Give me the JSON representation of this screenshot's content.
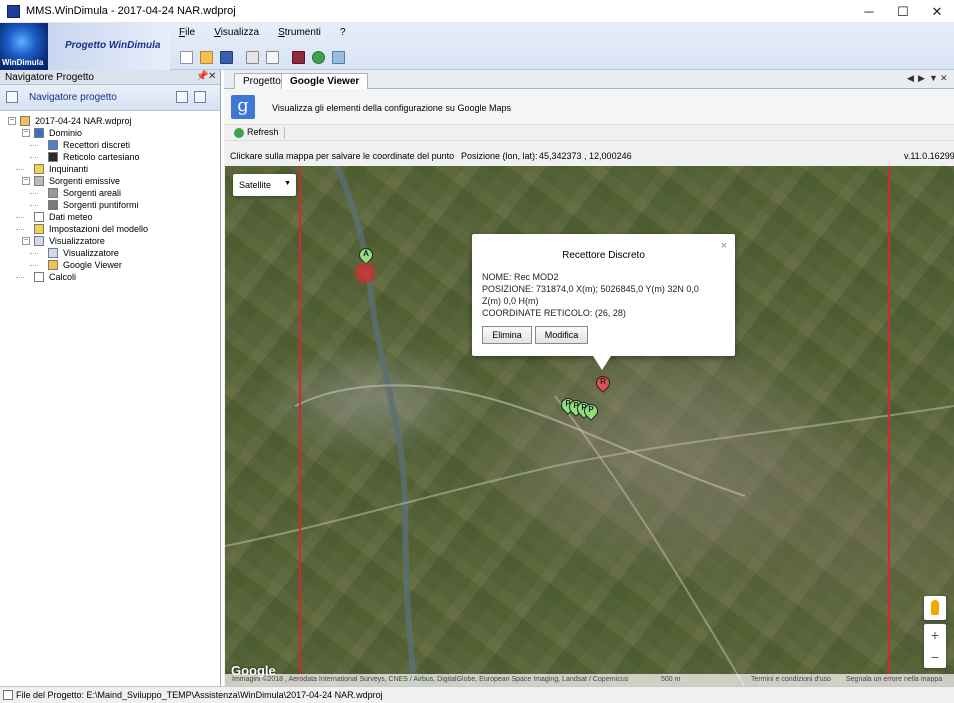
{
  "window": {
    "title": "MMS.WinDimula - 2017-04-24 NAR.wdproj",
    "minimize": "─",
    "maximize": "☐",
    "close": "✕"
  },
  "logo": {
    "text": "WinDimula",
    "project_label": "Progetto WinDimula"
  },
  "menu": [
    "File",
    "Visualizza",
    "Strumenti",
    "?"
  ],
  "toolbar_icons": [
    "new-file-icon",
    "open-folder-icon",
    "save-icon",
    "table-icon",
    "report-icon",
    "book-icon",
    "globe-icon",
    "export-icon"
  ],
  "navigator": {
    "title": "Navigatore Progetto",
    "pin": "📌",
    "close": "✕",
    "bar_label": "Navigatore progetto",
    "tree": [
      {
        "label": "2017-04-24 NAR.wdproj",
        "level": 0,
        "icon": "project-icon",
        "expand": "−"
      },
      {
        "label": "Dominio",
        "level": 1,
        "icon": "domain-icon",
        "expand": "−"
      },
      {
        "label": "Recettori discreti",
        "level": 2,
        "icon": "receptors-icon"
      },
      {
        "label": "Reticolo cartesiano",
        "level": 2,
        "icon": "grid-icon"
      },
      {
        "label": "Inquinanti",
        "level": 1,
        "icon": "pollutants-icon"
      },
      {
        "label": "Sorgenti emissive",
        "level": 1,
        "icon": "sources-icon",
        "expand": "−"
      },
      {
        "label": "Sorgenti areali",
        "level": 2,
        "icon": "area-sources-icon"
      },
      {
        "label": "Sorgenti puntiformi",
        "level": 2,
        "icon": "point-sources-icon"
      },
      {
        "label": "Dati meteo",
        "level": 1,
        "icon": "meteo-icon"
      },
      {
        "label": "Impostazioni del modello",
        "level": 1,
        "icon": "settings-icon"
      },
      {
        "label": "Visualizzatore",
        "level": 1,
        "icon": "viewer-icon",
        "expand": "−"
      },
      {
        "label": "Visualizzatore",
        "level": 2,
        "icon": "viewer-icon"
      },
      {
        "label": "Google Viewer",
        "level": 2,
        "icon": "google-viewer-icon"
      },
      {
        "label": "Calcoli",
        "level": 1,
        "icon": "calc-icon"
      }
    ]
  },
  "tabs": [
    {
      "label": "Progetto",
      "active": false
    },
    {
      "label": "Google Viewer",
      "active": true
    }
  ],
  "tab_controls": {
    "prev": "◀",
    "next": "▶",
    "menu": "▼",
    "close": "✕"
  },
  "google_viewer": {
    "logo": "g",
    "description": "Visualizza gli elementi della configurazione su Google Maps",
    "refresh_label": "Refresh",
    "hint": "Clickare sulla mappa per salvare le coordinate del punto",
    "position_label": "Posizione (lon, lat):",
    "position_value": "45,342373 , 12,000246",
    "version": "v.11.0.16299"
  },
  "map": {
    "map_type": "Satellite",
    "caret": "▼",
    "markers": [
      {
        "letter": "A",
        "color": "#8fe07a"
      },
      {
        "letter": "R",
        "color": "#e05050"
      },
      {
        "letter": "P",
        "color": "#8fe07a"
      },
      {
        "letter": "P",
        "color": "#8fe07a"
      },
      {
        "letter": "P",
        "color": "#8fe07a"
      },
      {
        "letter": "P",
        "color": "#8fe07a"
      }
    ],
    "popup": {
      "title": "Recettore Discreto",
      "close": "×",
      "lines": [
        "NOME: Rec MOD2",
        "POSIZIONE: 731874,0 X(m); 5026845,0 Y(m) 32N 0,0",
        "Z(m) 0,0 H(m)",
        "COORDINATE RETICOLO: (26, 28)"
      ],
      "delete_label": "Elimina",
      "modify_label": "Modifica"
    },
    "zoom_in": "+",
    "zoom_out": "−",
    "google_logo": "Google",
    "attribution": "Immagini ©2018 , Aerodata International Surveys, CNES / Airbus, DigitalGlobe, European Space Imaging, Landsat / Copernicus",
    "scale": "500 m",
    "terms": "Termini e condizioni d'uso",
    "report": "Segnala un errore nella mappa"
  },
  "status": {
    "text": "File del Progetto:  E:\\Maind_Sviluppo_TEMP\\Assistenza\\WinDimula\\2017-04-24 NAR.wdproj"
  }
}
